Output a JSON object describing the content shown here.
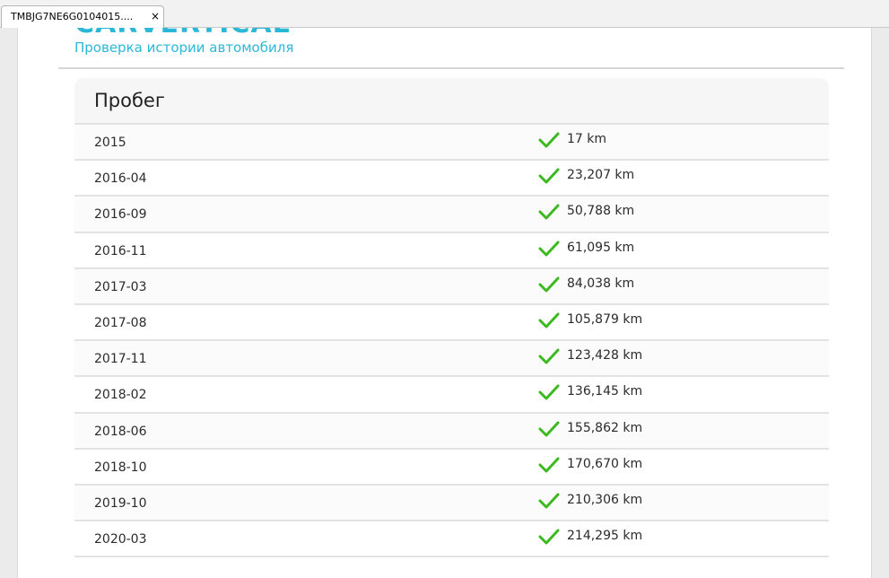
{
  "browser": {
    "tab_title": "TMBJG7NE6G0104015....",
    "tab_close": "×"
  },
  "header": {
    "logo_text": "CARVERTICAL",
    "subtitle": "Проверка истории автомобиля",
    "brand_color": "#2bb8d8"
  },
  "mileage": {
    "title": "Пробег",
    "check_color": "#3cb91f",
    "rows": [
      {
        "date": "2015",
        "km": "17 km"
      },
      {
        "date": "2016-04",
        "km": "23,207 km"
      },
      {
        "date": "2016-09",
        "km": "50,788 km"
      },
      {
        "date": "2016-11",
        "km": "61,095 km"
      },
      {
        "date": "2017-03",
        "km": "84,038 km"
      },
      {
        "date": "2017-08",
        "km": "105,879 km"
      },
      {
        "date": "2017-11",
        "km": "123,428 km"
      },
      {
        "date": "2018-02",
        "km": "136,145 km"
      },
      {
        "date": "2018-06",
        "km": "155,862 km"
      },
      {
        "date": "2018-10",
        "km": "170,670 km"
      },
      {
        "date": "2019-10",
        "km": "210,306 km"
      },
      {
        "date": "2020-03",
        "km": "214,295 km"
      }
    ]
  }
}
